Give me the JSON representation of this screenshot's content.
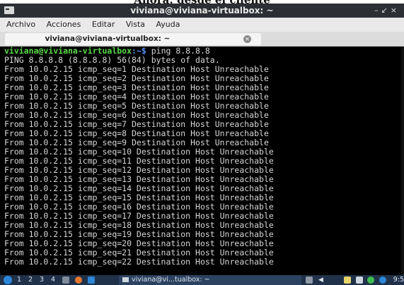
{
  "heading_partial": "Ahora: desde el cliente",
  "window": {
    "title": "viviana@viviana-virtualbox: ~",
    "controls": [
      "–",
      "↙",
      "×"
    ]
  },
  "menu": [
    "Archivo",
    "Acciones",
    "Editar",
    "Vista",
    "Ayuda"
  ],
  "tab": {
    "label": "viviana@viviana-virtualbox: ~"
  },
  "terminal": {
    "prompt_user": "viviana@viviana-virtualbox",
    "prompt_path": ":~$",
    "command": " ping 8.8.8.8",
    "lines": [
      "PING 8.8.8.8 (8.8.8.8) 56(84) bytes of data.",
      "From 10.0.2.15 icmp_seq=1 Destination Host Unreachable",
      "From 10.0.2.15 icmp_seq=2 Destination Host Unreachable",
      "From 10.0.2.15 icmp_seq=3 Destination Host Unreachable",
      "From 10.0.2.15 icmp_seq=4 Destination Host Unreachable",
      "From 10.0.2.15 icmp_seq=5 Destination Host Unreachable",
      "From 10.0.2.15 icmp_seq=6 Destination Host Unreachable",
      "From 10.0.2.15 icmp_seq=7 Destination Host Unreachable",
      "From 10.0.2.15 icmp_seq=8 Destination Host Unreachable",
      "From 10.0.2.15 icmp_seq=9 Destination Host Unreachable",
      "From 10.0.2.15 icmp_seq=10 Destination Host Unreachable",
      "From 10.0.2.15 icmp_seq=11 Destination Host Unreachable",
      "From 10.0.2.15 icmp_seq=12 Destination Host Unreachable",
      "From 10.0.2.15 icmp_seq=13 Destination Host Unreachable",
      "From 10.0.2.15 icmp_seq=14 Destination Host Unreachable",
      "From 10.0.2.15 icmp_seq=15 Destination Host Unreachable",
      "From 10.0.2.15 icmp_seq=16 Destination Host Unreachable",
      "From 10.0.2.15 icmp_seq=17 Destination Host Unreachable",
      "From 10.0.2.15 icmp_seq=18 Destination Host Unreachable",
      "From 10.0.2.15 icmp_seq=19 Destination Host Unreachable",
      "From 10.0.2.15 icmp_seq=20 Destination Host Unreachable",
      "From 10.0.2.15 icmp_seq=21 Destination Host Unreachable",
      "From 10.0.2.15 icmp_seq=22 Destination Host Unreachable"
    ]
  },
  "taskbar": {
    "workspaces": [
      "1",
      "2",
      "3",
      "4"
    ],
    "task_label": "viviana@vi...tualbox: ~",
    "clock": "9:5"
  },
  "colors": {
    "prompt_user": "#5ad94a",
    "prompt_path": "#4f8ef7",
    "terminal_bg": "#000000",
    "titlebar_bg": "#2c2f33",
    "taskbar_bg": "#20324a"
  }
}
